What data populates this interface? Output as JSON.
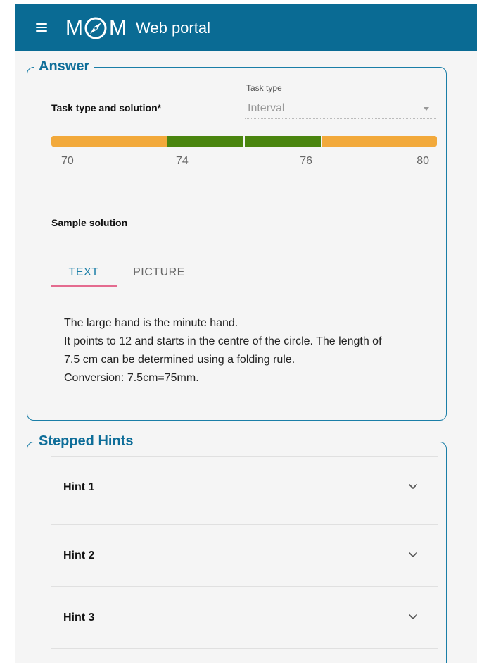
{
  "header": {
    "logo_left": "M",
    "logo_right": "M",
    "title": "Web portal",
    "background": "#0a6b94"
  },
  "answer": {
    "legend": "Answer",
    "task_label": "Task type and solution*",
    "task_type_caption": "Task type",
    "task_type_value": "Interval",
    "interval": {
      "values": [
        "70",
        "74",
        "76",
        "80"
      ],
      "colors": {
        "outer": "#f2a93b",
        "inner": "#4a850f"
      }
    },
    "sample_solution_label": "Sample solution",
    "tabs": [
      {
        "label": "TEXT",
        "active": true
      },
      {
        "label": "PICTURE",
        "active": false
      }
    ],
    "solution_lines": [
      "The large hand is the minute hand.",
      "It points to 12 and starts in the centre of the circle. The length of",
      "7.5 cm can be determined using a folding rule.",
      "Conversion: 7.5cm=75mm."
    ]
  },
  "hints": {
    "legend": "Stepped Hints",
    "items": [
      {
        "label": "Hint 1"
      },
      {
        "label": "Hint 2"
      },
      {
        "label": "Hint 3"
      }
    ]
  },
  "accent": "#1a7ea7",
  "tab_indicator_color": "#e46b8f"
}
